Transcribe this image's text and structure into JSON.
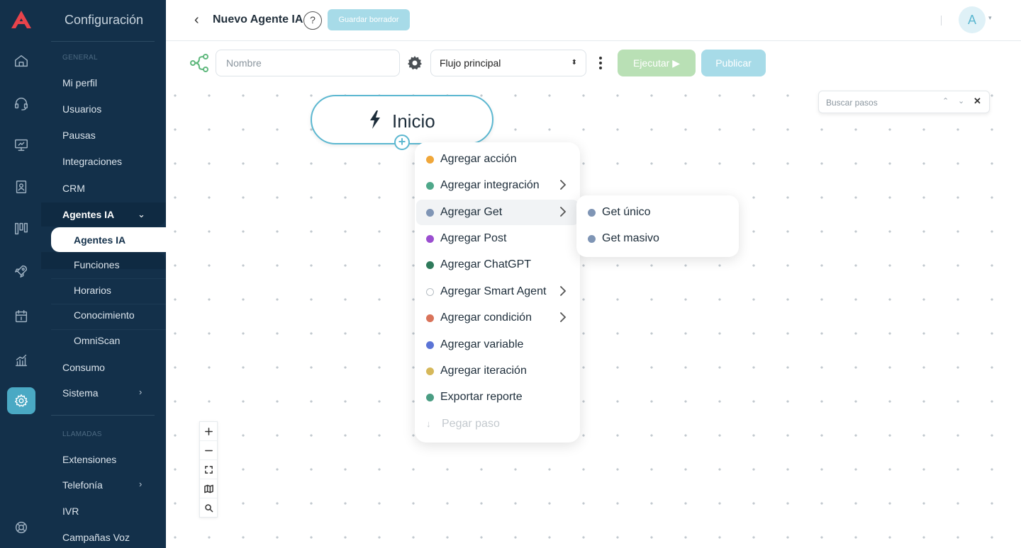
{
  "sidebar": {
    "title": "Configuración",
    "section_general": "GENERAL",
    "section_calls": "LLAMADAS",
    "items": {
      "mi_perfil": "Mi perfil",
      "usuarios": "Usuarios",
      "pausas": "Pausas",
      "integraciones": "Integraciones",
      "crm": "CRM",
      "agentes_ia": "Agentes IA",
      "consumo": "Consumo",
      "sistema": "Sistema",
      "extensiones": "Extensiones",
      "telefonia": "Telefonía",
      "ivr": "IVR",
      "campanas_voz": "Campañas Voz"
    },
    "sub_items": {
      "agentes_ia": "Agentes IA",
      "funciones": "Funciones",
      "horarios": "Horarios",
      "conocimiento": "Conocimiento",
      "omniscan": "OmniScan"
    },
    "chevron_right": "›",
    "chevron_down": "⌄"
  },
  "header": {
    "back": "‹",
    "title": "Nuevo Agente IA",
    "help": "?",
    "draft_button": "Guardar borrador",
    "avatar_initial": "A",
    "avatar_caret": "▾"
  },
  "toolbar": {
    "name_placeholder": "Nombre",
    "flow_select_value": "Flujo principal",
    "select_arrows": "⬍",
    "run_button": "Ejecutar ▶",
    "publish_button": "Publicar"
  },
  "canvas": {
    "search_placeholder": "Buscar pasos",
    "search_up": "⌃",
    "search_down": "⌄",
    "search_close": "✕",
    "start_node_label": "Inicio",
    "add_handle": "+"
  },
  "menu": {
    "items": [
      {
        "label": "Agregar acción",
        "color": "#f0a73a",
        "submenu": false
      },
      {
        "label": "Agregar integración",
        "color": "#4fa88a",
        "submenu": true
      },
      {
        "label": "Agregar Get",
        "color": "#7f95b5",
        "submenu": true
      },
      {
        "label": "Agregar Post",
        "color": "#9b4fd0",
        "submenu": false
      },
      {
        "label": "Agregar ChatGPT",
        "color": "#2f7a5b",
        "submenu": false
      },
      {
        "label": "Agregar Smart Agent",
        "color": "#ffffff",
        "submenu": true
      },
      {
        "label": "Agregar condición",
        "color": "#d9735a",
        "submenu": true
      },
      {
        "label": "Agregar variable",
        "color": "#5b74d6",
        "submenu": false
      },
      {
        "label": "Agregar iteración",
        "color": "#d6b85a",
        "submenu": false
      },
      {
        "label": "Exportar reporte",
        "color": "#4a9d83",
        "submenu": false
      }
    ],
    "paste_label": "Pegar paso",
    "paste_icon": "↓"
  },
  "submenu": {
    "items": [
      {
        "label": "Get único",
        "color": "#7f95b5"
      },
      {
        "label": "Get masivo",
        "color": "#7f95b5"
      }
    ]
  },
  "colors": {
    "sidebar_bg": "#13304a",
    "accent": "#5bb7d0",
    "run_button": "#b9e0b5",
    "publish_button": "#a7dbe8"
  }
}
